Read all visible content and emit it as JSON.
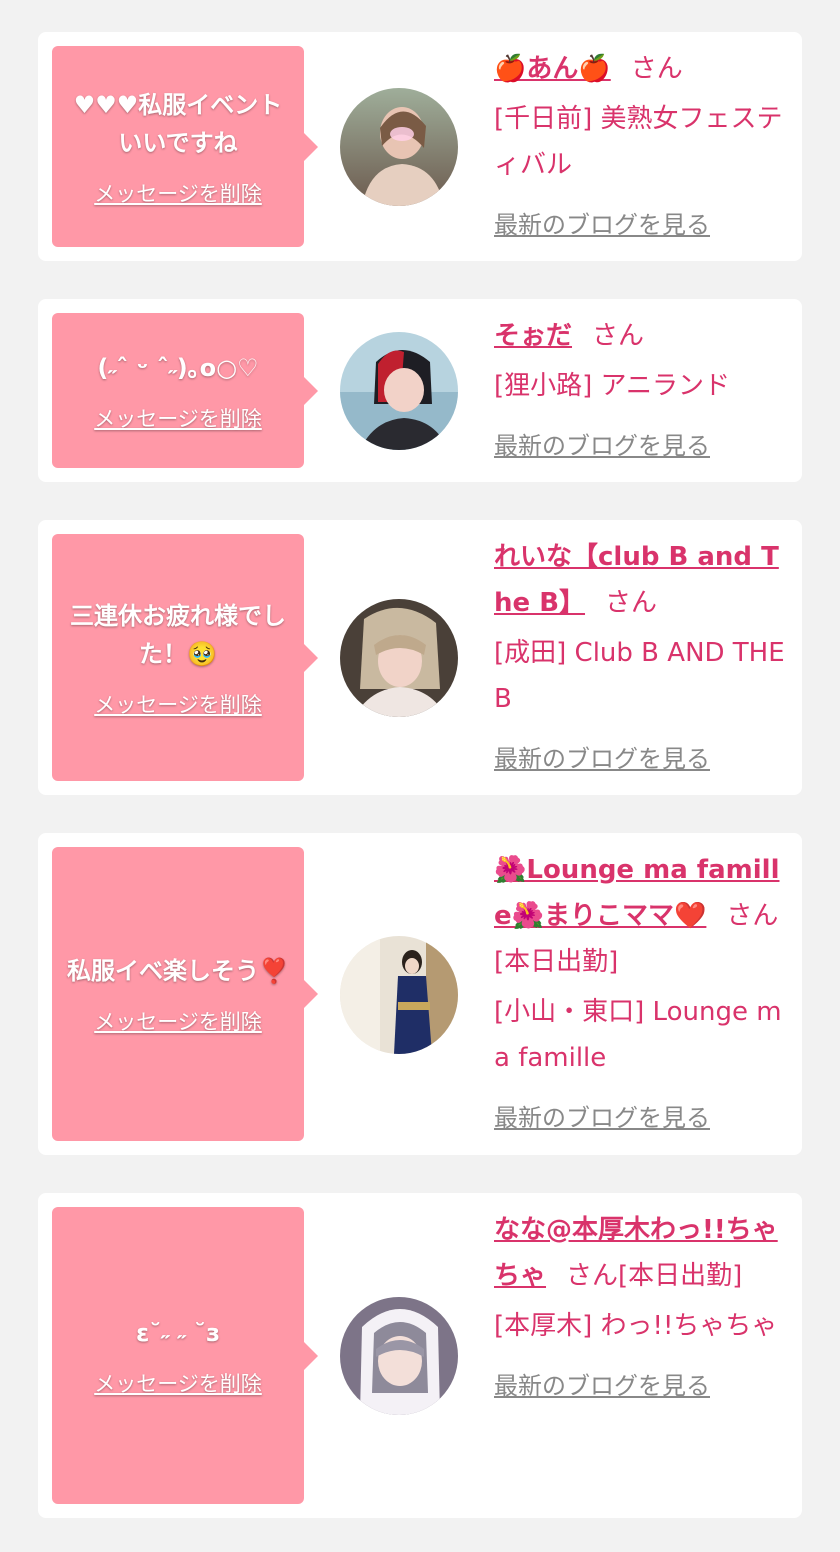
{
  "cards": [
    {
      "message": "♥♥♥私服イベントいいですね",
      "delete_label": "メッセージを削除",
      "name": "🍎あん🍎",
      "honorific": "さん",
      "shop": "[千日前] 美熟女フェスティバル",
      "blog_label": "最新のブログを見る"
    },
    {
      "message": "(˶ˆ ᵕ ˆ˶)｡o○♡",
      "delete_label": "メッセージを削除",
      "name": "そぉだ",
      "honorific": "さん",
      "shop": "[狸小路] アニランド",
      "blog_label": "最新のブログを見る"
    },
    {
      "message": "三連休お疲れ様でした！🥹",
      "delete_label": "メッセージを削除",
      "name": "れいな【club B and The B】",
      "honorific": "さん",
      "shop": "[成田] Club B AND THE B",
      "blog_label": "最新のブログを見る"
    },
    {
      "message": "私服イベ楽しそう❣️",
      "delete_label": "メッセージを削除",
      "name": "🌺Lounge ma famille🌺まりこママ❤️",
      "honorific": "さん[本日出勤]",
      "shop": "[小山・東口] Lounge ma famille",
      "blog_label": "最新のブログを見る"
    },
    {
      "message": "ε˘˶ ˶ ˘з",
      "delete_label": "メッセージを削除",
      "name": "なな@本厚木わっ!!ちゃちゃ",
      "honorific": "さん[本日出勤]",
      "shop": "[本厚木] わっ!!ちゃちゃ",
      "blog_label": "最新のブログを見る"
    }
  ],
  "colors": {
    "bubble": "#ff98a7",
    "accent": "#d9336b",
    "link_gray": "#888888",
    "background": "#f2f2f2"
  }
}
